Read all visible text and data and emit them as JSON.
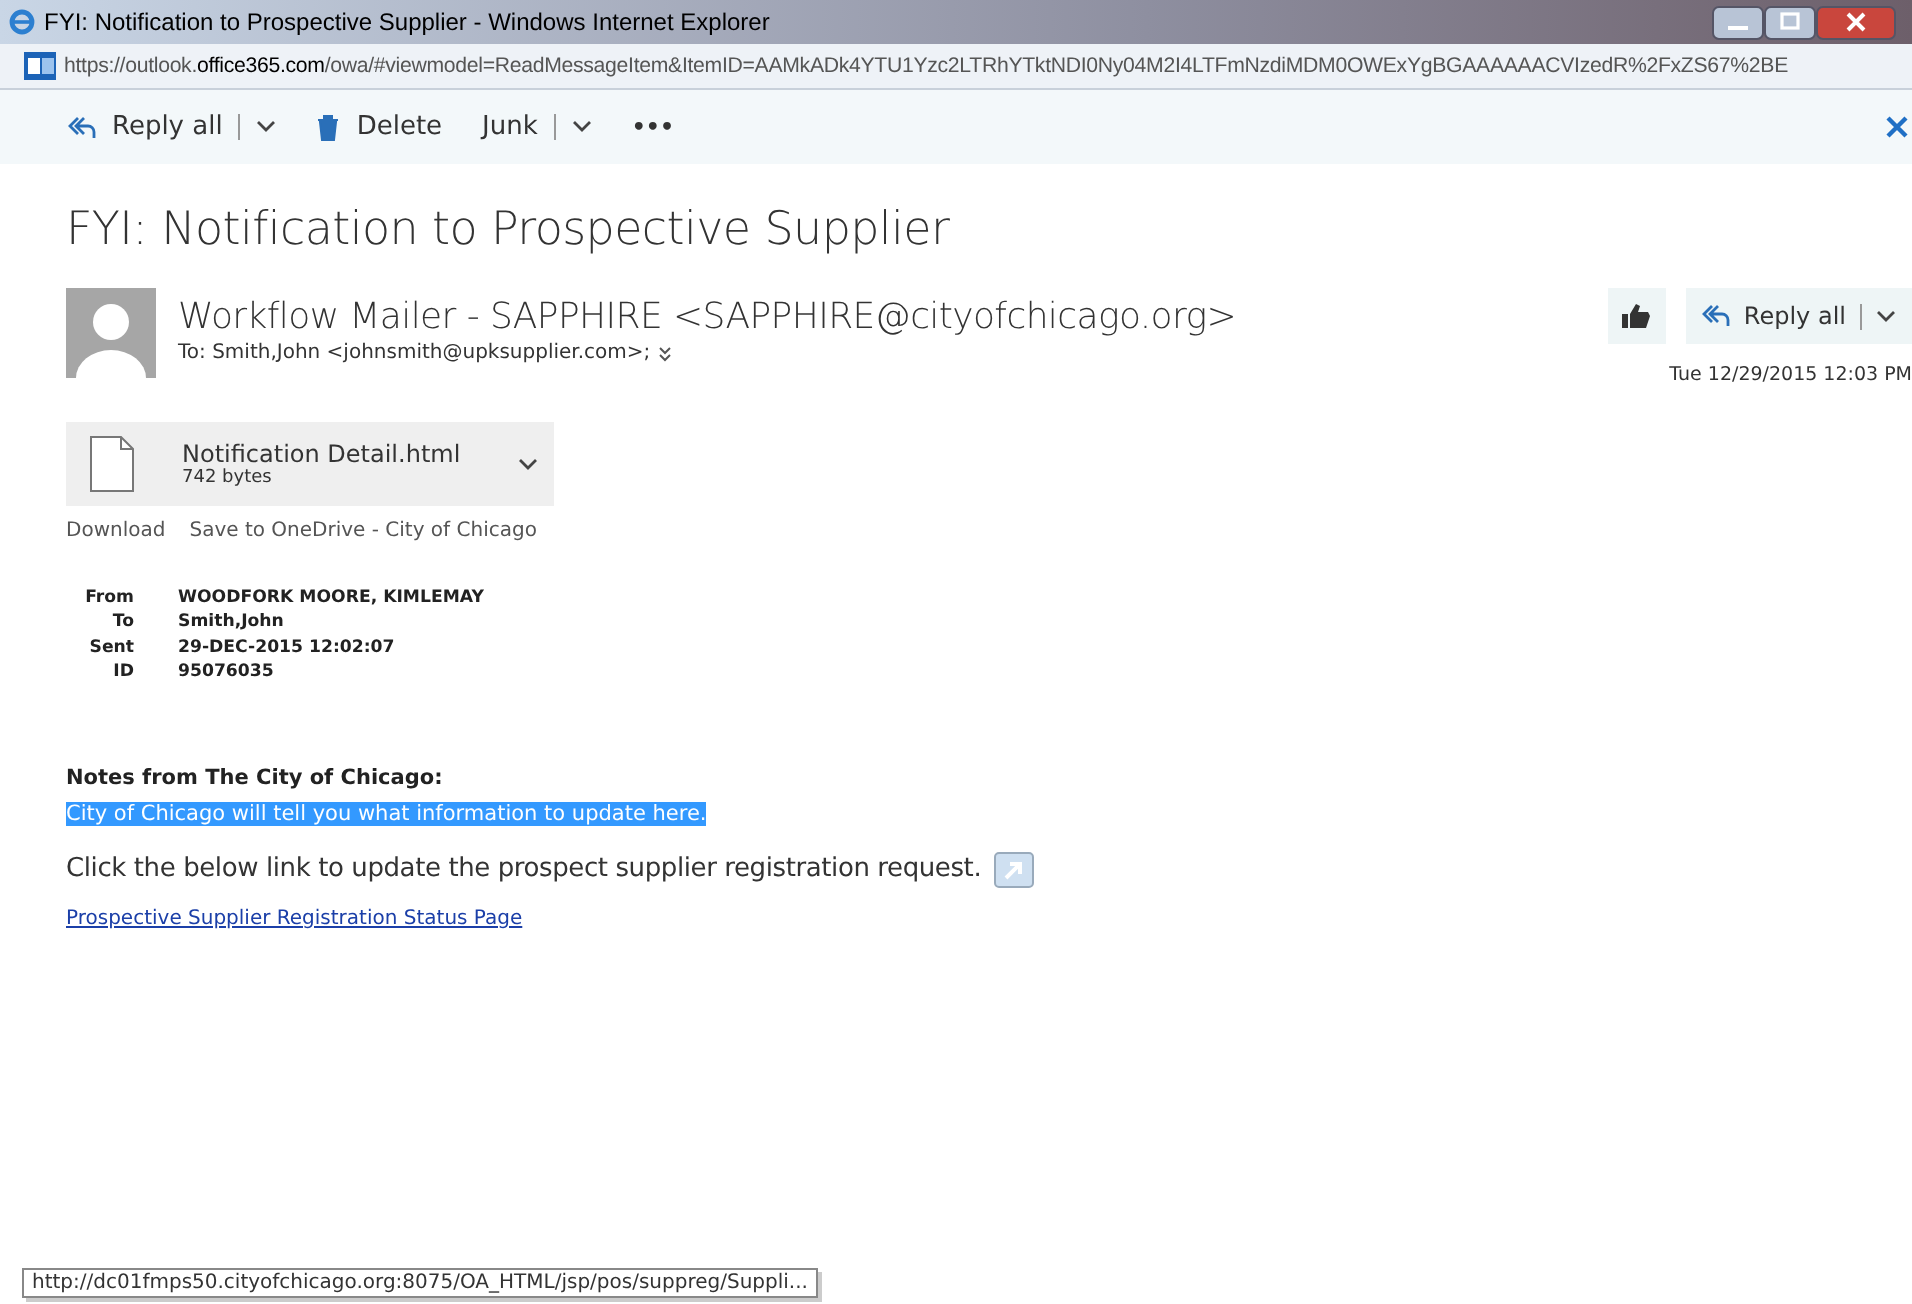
{
  "window": {
    "title": "FYI: Notification to Prospective Supplier - Windows Internet Explorer"
  },
  "address": {
    "url_start": "https://outlook.",
    "url_domain": "office365.com",
    "url_rest": "/owa/#viewmodel=ReadMessageItem&ItemID=AAMkADk4YTU1Yzc2LTRhYTktNDI0Ny04M2I4LTFmNzdiMDM0OWExYgBGAAAAAACVIzedR%2FxZS67%2BE"
  },
  "toolbar": [
    {
      "kind": "reply",
      "label": "Reply all",
      "dropdown": true
    },
    {
      "kind": "delete",
      "label": "Delete",
      "dropdown": false
    },
    {
      "kind": "plain",
      "label": "Junk",
      "dropdown": true
    },
    {
      "kind": "more",
      "label": "•••",
      "dropdown": false
    }
  ],
  "message": {
    "subject": "FYI: Notification to Prospective Supplier",
    "sender": "Workflow Mailer - SAPPHIRE <SAPPHIRE@cityofchicago.org>",
    "to": "To: Smith,John <johnsmith@upksupplier.com>;",
    "reply_label": "Reply all",
    "date": "Tue 12/29/2015 12:03 PM",
    "attachment": {
      "name": "Notification Detail.html",
      "size": "742 bytes"
    },
    "attachment_actions": [
      "Download",
      "Save to OneDrive - City of Chicago"
    ],
    "details": [
      {
        "label": "From",
        "value": "WOODFORK MOORE, KIMLEMAY"
      },
      {
        "label": "To",
        "value": "Smith,John"
      },
      {
        "label": "Sent",
        "value": "29-DEC-2015 12:02:07"
      },
      {
        "label": "ID",
        "value": "95076035"
      }
    ],
    "notes_title": "Notes from The City of Chicago:",
    "notes": {
      "text": "City of Chicago will tell you what information to update here.",
      "selected": true
    },
    "instruction": "Click the below link to update the prospect supplier registration request.",
    "link": "Prospective Supplier Registration Status Page"
  },
  "status_bar": "http://dc01fmps50.cityofchicago.org:8075/OA_HTML/jsp/pos/suppreg/Suppli..."
}
